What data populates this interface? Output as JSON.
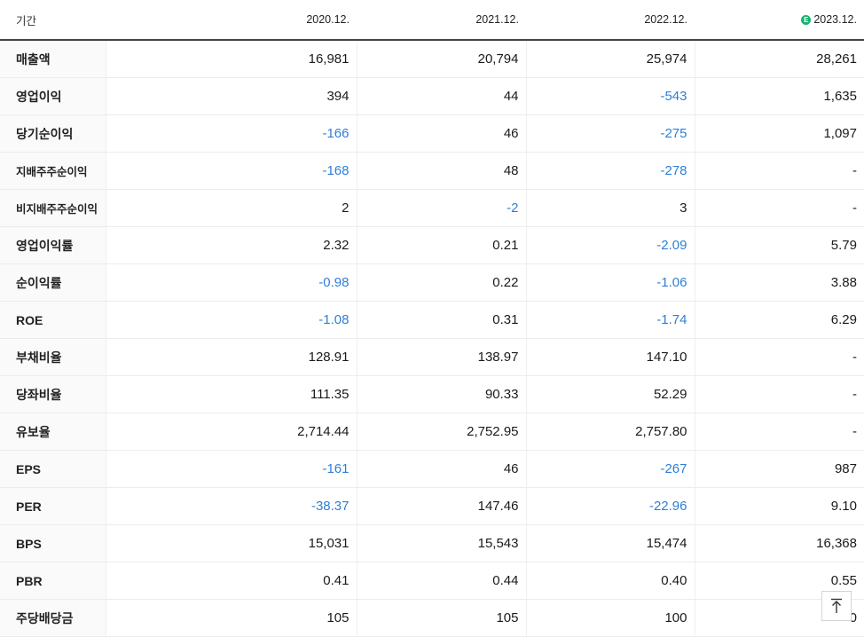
{
  "table": {
    "header": [
      "기간",
      "2020.12.",
      "2021.12.",
      "2022.12.",
      "2023.12."
    ],
    "estimate_badge": "E",
    "rows": [
      {
        "label": "매출액",
        "values": [
          "16,981",
          "20,794",
          "25,974",
          "28,261"
        ]
      },
      {
        "label": "영업이익",
        "values": [
          "394",
          "44",
          "-543",
          "1,635"
        ]
      },
      {
        "label": "당기순이익",
        "values": [
          "-166",
          "46",
          "-275",
          "1,097"
        ]
      },
      {
        "label": "지배주주순이익",
        "values": [
          "-168",
          "48",
          "-278",
          "-"
        ]
      },
      {
        "label": "비지배주주순이익",
        "values": [
          "2",
          "-2",
          "3",
          "-"
        ]
      },
      {
        "label": "영업이익률",
        "values": [
          "2.32",
          "0.21",
          "-2.09",
          "5.79"
        ]
      },
      {
        "label": "순이익률",
        "values": [
          "-0.98",
          "0.22",
          "-1.06",
          "3.88"
        ]
      },
      {
        "label": "ROE",
        "values": [
          "-1.08",
          "0.31",
          "-1.74",
          "6.29"
        ]
      },
      {
        "label": "부채비율",
        "values": [
          "128.91",
          "138.97",
          "147.10",
          "-"
        ]
      },
      {
        "label": "당좌비율",
        "values": [
          "111.35",
          "90.33",
          "52.29",
          "-"
        ]
      },
      {
        "label": "유보율",
        "values": [
          "2,714.44",
          "2,752.95",
          "2,757.80",
          "-"
        ]
      },
      {
        "label": "EPS",
        "values": [
          "-161",
          "46",
          "-267",
          "987"
        ]
      },
      {
        "label": "PER",
        "values": [
          "-38.37",
          "147.46",
          "-22.96",
          "9.10"
        ]
      },
      {
        "label": "BPS",
        "values": [
          "15,031",
          "15,543",
          "15,474",
          "16,368"
        ]
      },
      {
        "label": "PBR",
        "values": [
          "0.41",
          "0.44",
          "0.40",
          "0.55"
        ]
      },
      {
        "label": "주당배당금",
        "values": [
          "105",
          "105",
          "100",
          "0"
        ]
      }
    ]
  },
  "colors": {
    "negative": "#2f7fd6",
    "estimate_badge": "#18b06e"
  },
  "icons": {
    "scroll_top": "arrow-up-to-line-icon"
  }
}
